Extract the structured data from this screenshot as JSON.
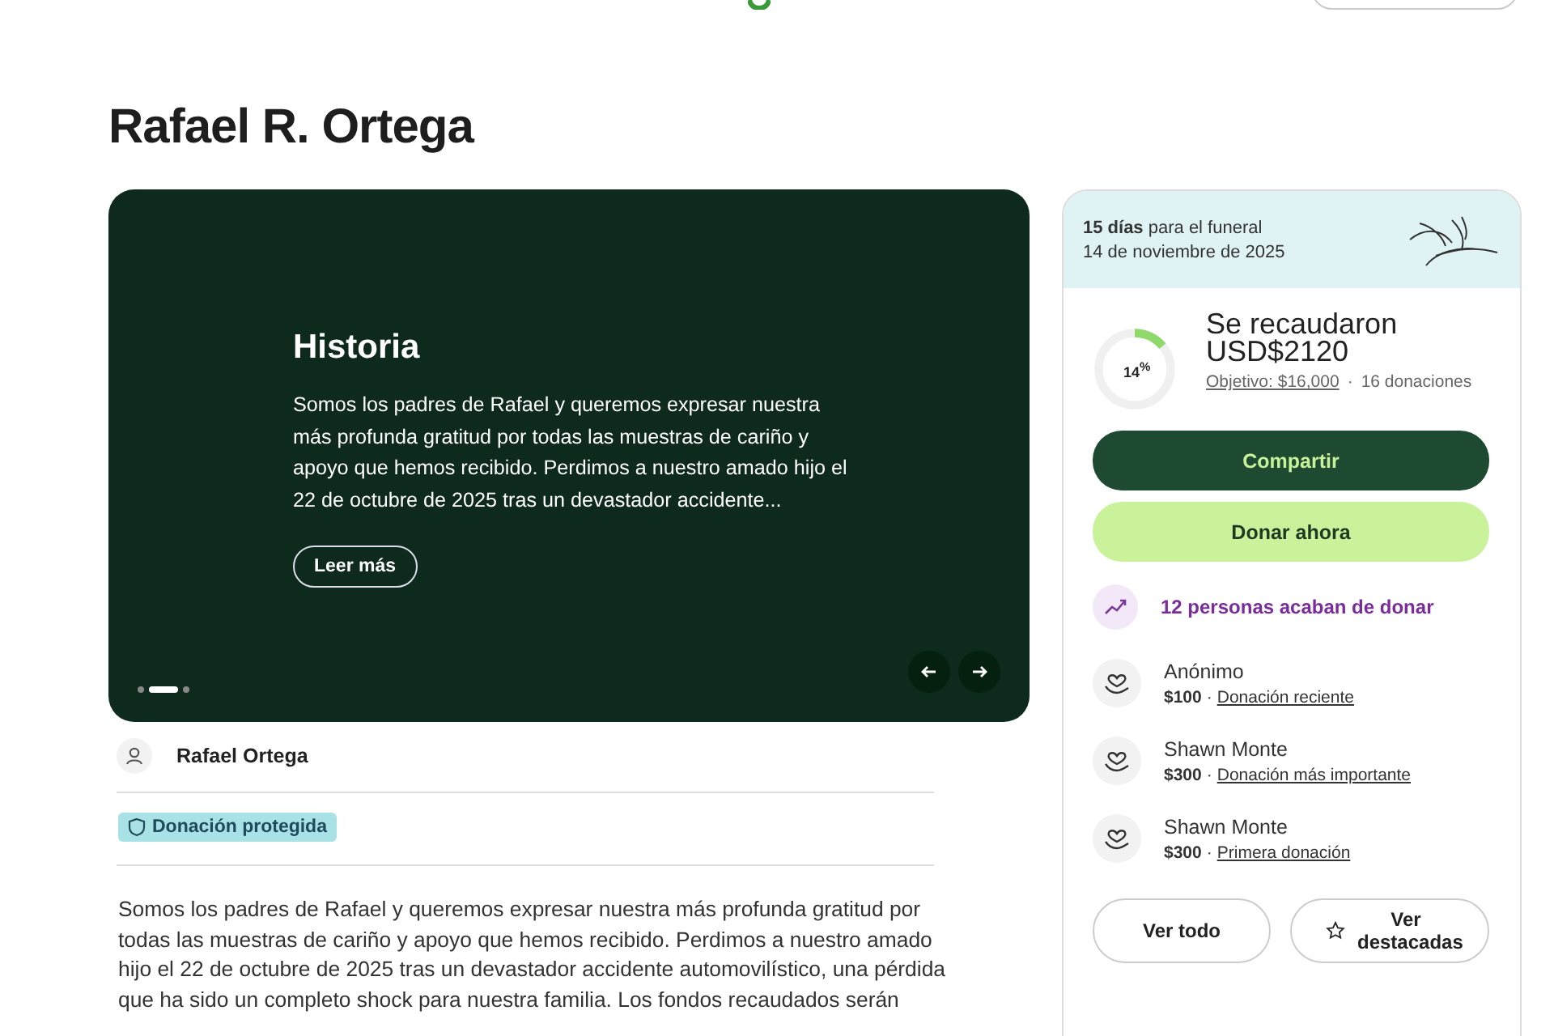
{
  "title": "Rafael R. Ortega",
  "story": {
    "heading": "Historia",
    "excerpt": "Somos los padres de Rafael y queremos expresar nuestra más profunda gratitud por todas las muestras de cariño y apoyo que hemos recibido. Perdimos a nuestro amado hijo el 22 de octubre de 2025 tras un devastador accidente...",
    "button": "Leer más",
    "dots": [
      {
        "selected": false
      },
      {
        "selected": true
      },
      {
        "selected": false
      }
    ]
  },
  "organizer": {
    "name": "Rafael Ortega"
  },
  "badge": "Donación protegida",
  "body": "Somos los padres de Rafael y queremos expresar nuestra más profunda gratitud por todas las muestras de cariño y apoyo que hemos recibido. Perdimos a nuestro amado hijo el 22 de octubre de 2025 tras un devastador accidente automovilístico, una pérdida que ha sido un completo shock para nuestra familia. Los fondos recaudados serán",
  "sidebar": {
    "countdown": "**15 días** para el funeral",
    "date": "14 de noviembre de 2025",
    "progress": {
      "level": 0.14,
      "percent": "14$^{%}$"
    },
    "raised": "Se recaudaron USD$2120",
    "goal": "Objetivo: $16,000",
    "separator": "·",
    "donations": "16 donaciones",
    "buttons": [
      {
        "label": "Compartir",
        "kind": "dark"
      },
      {
        "label": "Donar ahora",
        "kind": "light"
      }
    ],
    "recent": "12 personas acaban de donar",
    "donors": [
      {
        "name": "Anónimo",
        "amount": "$100",
        "separator": "·",
        "tag": "Donación reciente"
      },
      {
        "name": "Shawn Monte",
        "amount": "$300",
        "separator": "·",
        "tag": "Donación más importante"
      },
      {
        "name": "Shawn Monte",
        "amount": "$300",
        "separator": "·",
        "tag": "Primera donación"
      }
    ],
    "footer_buttons": [
      {
        "label": "Ver todo",
        "kind": "plain"
      },
      {
        "label": "Ver destacadas",
        "kind": "star"
      }
    ]
  }
}
